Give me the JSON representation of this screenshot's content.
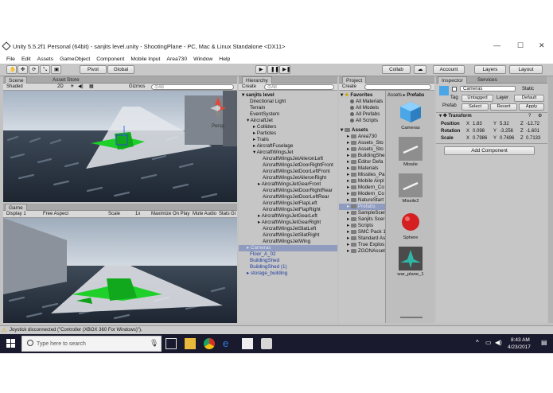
{
  "window": {
    "title": "Unity 5.5.2f1 Personal (64bit) - sanjits level.unity - ShootingPlane - PC, Mac & Linux Standalone <DX11>",
    "controls": [
      "—",
      "☐",
      "✕"
    ]
  },
  "menu": [
    "File",
    "Edit",
    "Assets",
    "GameObject",
    "Component",
    "Mobile Input",
    "Area730",
    "Window",
    "Help"
  ],
  "toolbar": {
    "pivot": "Pivot",
    "global": "Global",
    "collab": "Collab",
    "account": "Account",
    "layers": "Layers",
    "layout": "Layout"
  },
  "scene": {
    "tab_scene": "Scene",
    "tab_store": "Asset Store",
    "shading": "Shaded",
    "mode2d": "2D",
    "gizmos": "Gizmos",
    "search": "⊙All",
    "persp": "Persp"
  },
  "game": {
    "tab": "Game",
    "display": "Display 1",
    "aspect": "Free Aspect",
    "scale_label": "Scale",
    "scale_value": "1x",
    "maximize": "Maximize On Play",
    "mute": "Mute Audio",
    "stats": "Stats",
    "gizmos": "Gi"
  },
  "hierarchy": {
    "tab": "Hierarchy",
    "create": "Create",
    "search": "⊙All",
    "items": [
      "sanjits level",
      "Directional Light",
      "Terrain",
      "EventSystem",
      "AircraftJet",
      "Colliders",
      "Particles",
      "Trails",
      "AircraftFuselage",
      "AircraftWingsJet",
      "AircraftWingsJetAileronLeft",
      "AircraftWingsJetDoorRightFront",
      "AircraftWingsJetDoorLeftFront",
      "AircraftWingsJetAileronRight",
      "AircraftWingsJetGearFront",
      "AircraftWingsJetDoorRightRear",
      "AircraftWingsJetDoorLeftRear",
      "AircraftWingsJetFlapLeft",
      "AircraftWingsJetFlapRight",
      "AircraftWingsJetGearLeft",
      "AircraftWingsJetGearRight",
      "AircraftWingsJetSlatLeft",
      "AircraftWingsJetSlatRight",
      "AircraftWingsJetWing",
      "Cameras",
      "Floor_A_02",
      "BuildingShed",
      "BuildingShed (1)",
      "storage_building"
    ]
  },
  "project": {
    "tab": "Project",
    "create": "Create",
    "breadcrumb": [
      "Assets",
      "Prefabs"
    ],
    "favorites_label": "Favorites",
    "favorites": [
      "All Materials",
      "All Models",
      "All Prefabs",
      "All Scripts"
    ],
    "assets_label": "Assets",
    "folders": [
      "Area730",
      "Assets_Sto",
      "Assets_Sto",
      "BuildingShe",
      "Editor Defa",
      "Materials",
      "Missiles_Pa",
      "Mobile Airpl",
      "Modern_Co",
      "Modern_Co",
      "NatureStart",
      "Prefabs",
      "SampleScer",
      "Sanjits Scer",
      "Scripts",
      "SMC Pack 1",
      "Standard As",
      "True Explos",
      "ZGONAsset"
    ],
    "prefabs": [
      "Cameras",
      "Missile",
      "Missile2",
      "Sphere",
      "war_plane_1"
    ]
  },
  "inspector": {
    "tab": "Inspector",
    "tab2": "Services",
    "object_name": "Cameras",
    "static_label": "Static",
    "tag_label": "Tag",
    "tag_value": "Untagged",
    "layer_label": "Layer",
    "layer_value": "Default",
    "prefab_label": "Prefab",
    "select": "Select",
    "revert": "Revert",
    "apply": "Apply",
    "transform": "Transform",
    "rows": [
      {
        "label": "Position",
        "x": "1.83",
        "y": "5.32",
        "z": "-12.72"
      },
      {
        "label": "Rotation",
        "x": "0.098",
        "y": "-3.256",
        "z": "-1.601"
      },
      {
        "label": "Scale",
        "x": "0.7986",
        "y": "0.7696",
        "z": "0.7133"
      }
    ],
    "add_component": "Add Component"
  },
  "status": "Joystick disconnected (\"Controller (XBOX 360 For Windows)\").",
  "taskbar": {
    "search": "Type here to search",
    "time": "8:43 AM",
    "date": "4/23/2017"
  }
}
